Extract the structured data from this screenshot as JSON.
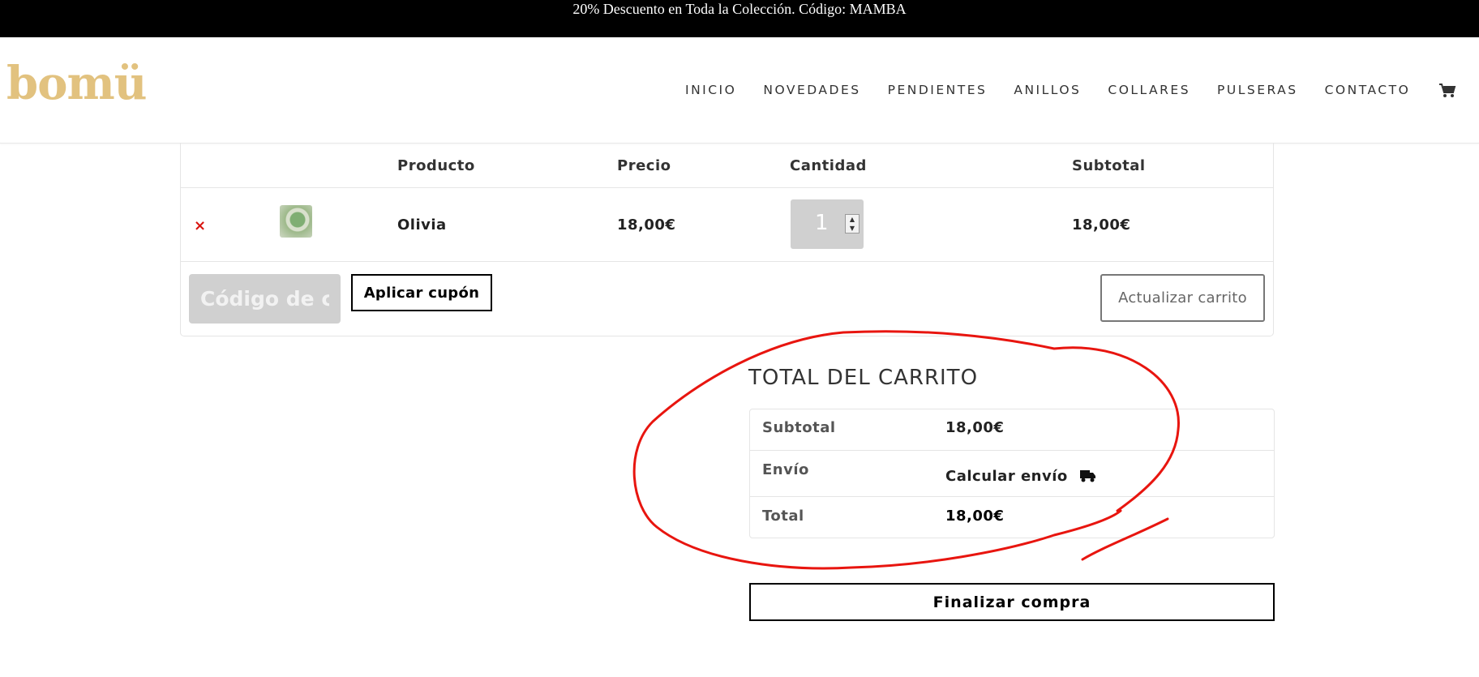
{
  "promo_bar": {
    "text": "20% Descuento en Toda la Colección. Código: MAMBA"
  },
  "header": {
    "logo": "bomü",
    "nav": [
      "INICIO",
      "NOVEDADES",
      "PENDIENTES",
      "ANILLOS",
      "COLLARES",
      "PULSERAS",
      "CONTACTO"
    ],
    "cart_icon": "shopping-cart-icon"
  },
  "cart": {
    "headers": {
      "product": "Producto",
      "price": "Precio",
      "quantity": "Cantidad",
      "subtotal": "Subtotal"
    },
    "items": [
      {
        "remove_symbol": "×",
        "name": "Olivia",
        "price": "18,00€",
        "quantity": "1",
        "subtotal": "18,00€"
      }
    ],
    "coupon_placeholder": "Código de cupón",
    "apply_coupon": "Aplicar cupón",
    "update_cart": "Actualizar carrito"
  },
  "totals": {
    "title": "TOTAL DEL CARRITO",
    "subtotal_label": "Subtotal",
    "subtotal_value": "18,00€",
    "shipping_label": "Envío",
    "shipping_value": "Calcular envío",
    "total_label": "Total",
    "total_value": "18,00€",
    "checkout_button": "Finalizar compra"
  },
  "colors": {
    "accent_logo": "#e2c27f",
    "remove": "#d9140f",
    "annotation": "#e8150f"
  }
}
